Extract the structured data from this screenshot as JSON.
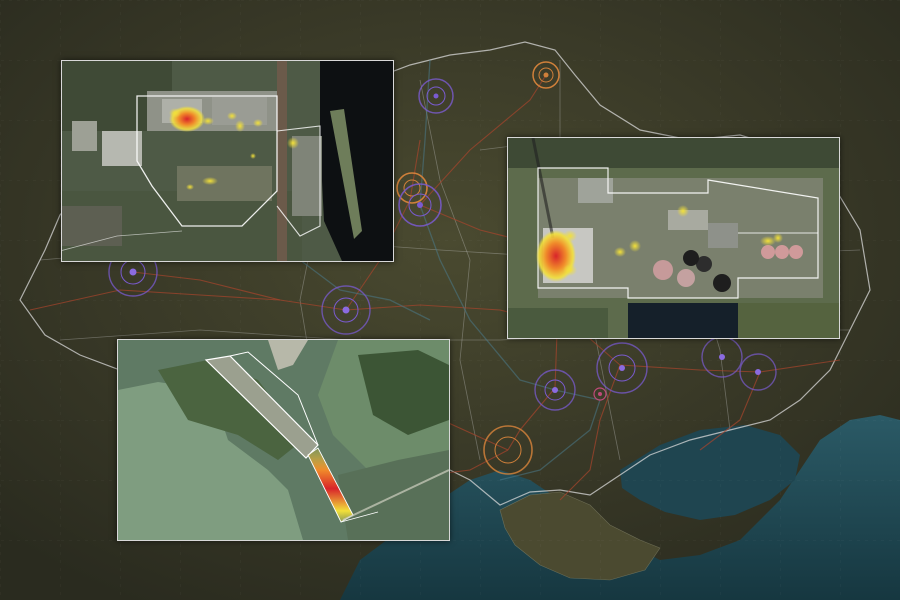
{
  "map": {
    "style": "satellite-dark",
    "colors": {
      "land": "#3a3d2a",
      "sea": "#1f4550",
      "border": "#d9d9d9",
      "roads": "#a8442c",
      "marker_purple": "#7a5bd0",
      "marker_orange": "#d0803a",
      "heat_low": "#f2e03a",
      "heat_mid": "#f08a2a",
      "heat_high": "#d8242a"
    },
    "markers": [
      {
        "id": "north-orange",
        "color": "orange",
        "icon": "target-circle-icon"
      },
      {
        "id": "north-purple",
        "color": "purple",
        "icon": "target-circle-icon"
      },
      {
        "id": "kyiv-orange",
        "color": "orange",
        "icon": "target-circle-icon"
      },
      {
        "id": "kyiv-purple",
        "color": "purple",
        "icon": "target-circle-icon"
      },
      {
        "id": "west-purple",
        "color": "purple",
        "icon": "target-circle-icon"
      },
      {
        "id": "central-purple",
        "color": "purple",
        "icon": "target-circle-icon"
      },
      {
        "id": "east-purple-1",
        "color": "purple",
        "icon": "target-circle-icon"
      },
      {
        "id": "east-purple-2",
        "color": "purple",
        "icon": "target-circle-icon"
      },
      {
        "id": "east-purple-3",
        "color": "purple",
        "icon": "target-circle-icon"
      },
      {
        "id": "south-purple",
        "color": "purple",
        "icon": "target-circle-icon"
      },
      {
        "id": "south-orange",
        "color": "orange",
        "icon": "target-circle-icon"
      }
    ]
  },
  "insets": [
    {
      "id": "chnpp",
      "kind": "satellite-inset",
      "heat": "industrial-site"
    },
    {
      "id": "tpp",
      "kind": "satellite-inset",
      "heat": "power-plant"
    },
    {
      "id": "dam",
      "kind": "satellite-inset",
      "heat": "dam-breach"
    }
  ]
}
